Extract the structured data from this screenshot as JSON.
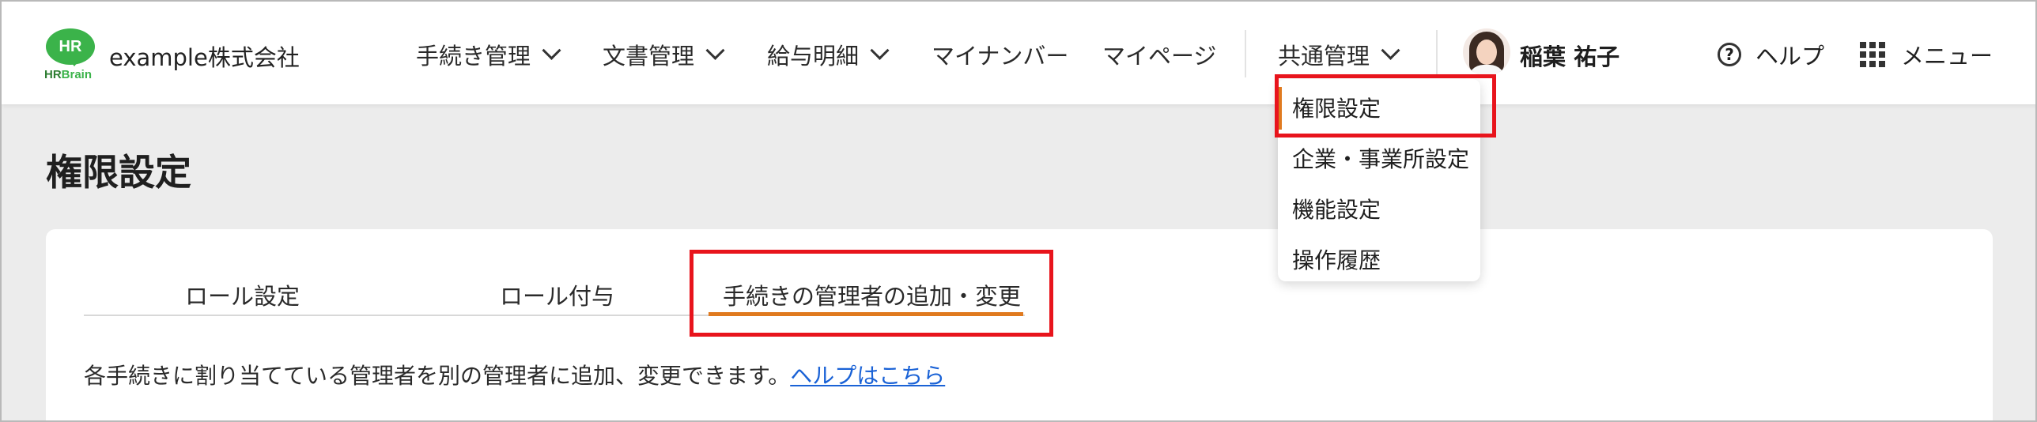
{
  "brand": {
    "logo_mark": "HR",
    "logo_word_hr": "HR",
    "logo_word_brain": "Brain",
    "company": "example株式会社",
    "accent_color": "#3bb34a"
  },
  "nav": {
    "procedures": "手続き管理",
    "documents": "文書管理",
    "payslips": "給与明細",
    "my_number": "マイナンバー",
    "my_page": "マイページ",
    "common": "共通管理"
  },
  "user": {
    "name": "稲葉 祐子"
  },
  "header_right": {
    "help": "ヘルプ",
    "menu": "メニュー"
  },
  "dropdown": {
    "items": [
      "権限設定",
      "企業・事業所設定",
      "機能設定",
      "操作履歴"
    ],
    "active_index": 0
  },
  "page": {
    "title": "権限設定",
    "tabs": [
      "ロール設定",
      "ロール付与",
      "手続きの管理者の追加・変更"
    ],
    "active_tab": 2,
    "description": "各手続きに割り当てている管理者を別の管理者に追加、変更できます。",
    "help_link": "ヘルプはこちら"
  },
  "colors": {
    "tab_active": "#e07a1f",
    "highlight_box": "#e8141c",
    "link": "#1a62d6"
  }
}
